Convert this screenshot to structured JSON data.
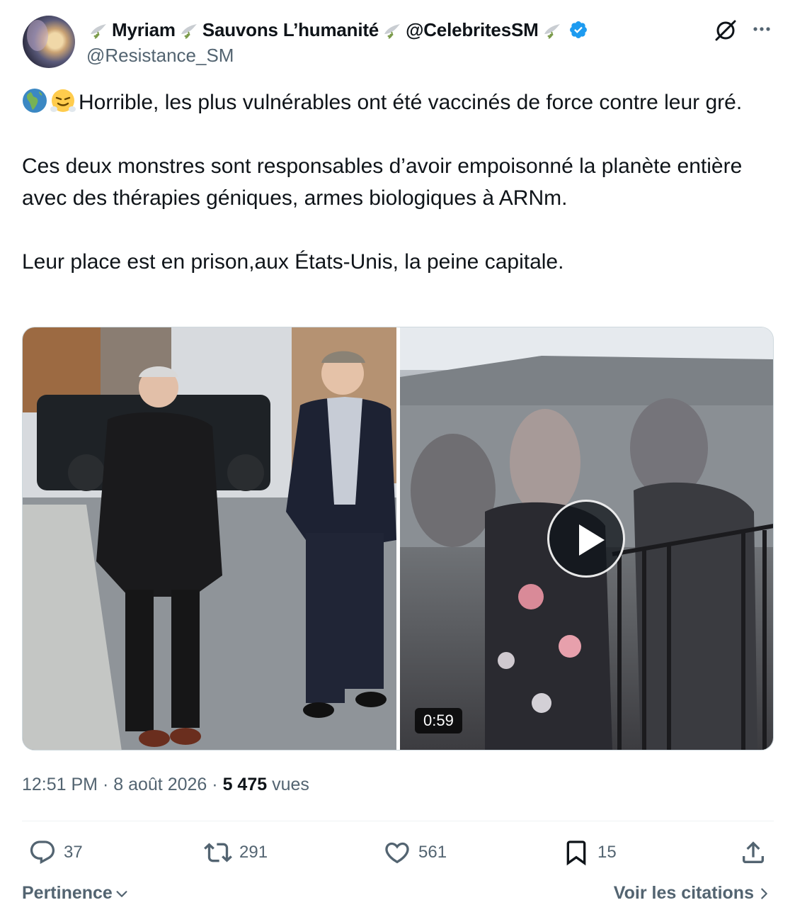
{
  "author": {
    "name_parts": [
      "Myriam",
      "Sauvons L’humanité",
      "@CelebritesSM"
    ],
    "handle": "@Resistance_SM",
    "avatar_icon": "avatar-photo",
    "verified_icon": "verified-badge-icon",
    "name_decoration_icon": "dove-olive-branch-icon"
  },
  "tweet": {
    "line1_emojis": [
      "earth-africa-emoji",
      "face-with-steam-emoji"
    ],
    "line1": "Horrible, les plus vulnérables ont été vaccinés de force contre leur gré.",
    "paragraph2": "Ces deux monstres sont responsables d’avoir empoisonné la planète entière avec des thérapies géniques, armes biologiques à ARNm.",
    "paragraph3": "Leur place est en prison,aux États-Unis, la peine capitale."
  },
  "media": {
    "video_duration": "0:59"
  },
  "meta": {
    "time": "12:51 PM",
    "separator": "·",
    "date": "8 août 2026",
    "views_count": "5 475",
    "views_label": "vues"
  },
  "actions": {
    "replies": "37",
    "reposts": "291",
    "likes": "561",
    "bookmarks": "15"
  },
  "footer": {
    "sort_label": "Pertinence",
    "quotes_label": "Voir les citations"
  },
  "colors": {
    "text_primary": "#0f1419",
    "text_secondary": "#536471",
    "verified_blue": "#1d9bf0",
    "border": "#cfd9de"
  }
}
